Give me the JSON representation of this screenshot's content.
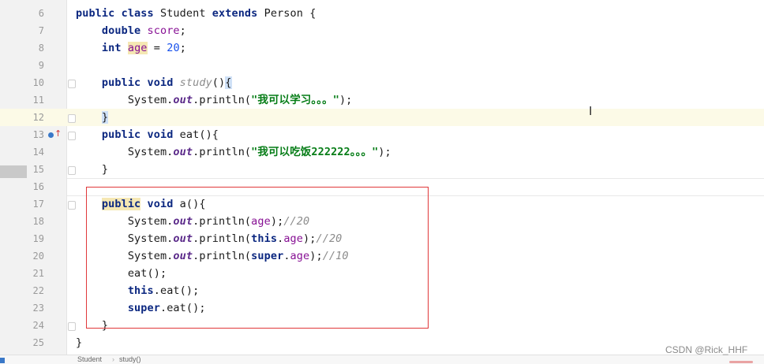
{
  "editor": {
    "lines": [
      {
        "num": "6",
        "parts": [
          {
            "t": "public class ",
            "c": "kw"
          },
          {
            "t": "Student ",
            "c": "par"
          },
          {
            "t": "extends ",
            "c": "kw"
          },
          {
            "t": "Person {",
            "c": "par"
          }
        ]
      },
      {
        "num": "7",
        "parts": [
          {
            "t": "    ",
            "c": "par"
          },
          {
            "t": "double ",
            "c": "kw"
          },
          {
            "t": "score",
            "c": "fld"
          },
          {
            "t": ";",
            "c": "par"
          }
        ]
      },
      {
        "num": "8",
        "parts": [
          {
            "t": "    ",
            "c": "par"
          },
          {
            "t": "int ",
            "c": "kw"
          },
          {
            "t": "age",
            "c": "fld hl-age"
          },
          {
            "t": " = ",
            "c": "par"
          },
          {
            "t": "20",
            "c": "num"
          },
          {
            "t": ";",
            "c": "par"
          }
        ]
      },
      {
        "num": "9",
        "parts": []
      },
      {
        "num": "10",
        "parts": [
          {
            "t": "    ",
            "c": "par"
          },
          {
            "t": "public void ",
            "c": "kw"
          },
          {
            "t": "study",
            "c": "cm"
          },
          {
            "t": "()",
            "c": "par"
          },
          {
            "t": "{",
            "c": "par hl-brace"
          }
        ]
      },
      {
        "num": "11",
        "parts": [
          {
            "t": "        System.",
            "c": "par"
          },
          {
            "t": "out",
            "c": "st"
          },
          {
            "t": ".println(",
            "c": "par"
          },
          {
            "t": "\"我可以学习。。。\"",
            "c": "str"
          },
          {
            "t": ");",
            "c": "par"
          }
        ]
      },
      {
        "num": "12",
        "parts": [
          {
            "t": "    ",
            "c": "par"
          },
          {
            "t": "}",
            "c": "par hl-brace"
          }
        ]
      },
      {
        "num": "13",
        "parts": [
          {
            "t": "    ",
            "c": "par"
          },
          {
            "t": "public void ",
            "c": "kw"
          },
          {
            "t": "eat(){",
            "c": "par"
          }
        ]
      },
      {
        "num": "14",
        "parts": [
          {
            "t": "        System.",
            "c": "par"
          },
          {
            "t": "out",
            "c": "st"
          },
          {
            "t": ".println(",
            "c": "par"
          },
          {
            "t": "\"我可以吃饭222222。。。\"",
            "c": "str"
          },
          {
            "t": ");",
            "c": "par"
          }
        ]
      },
      {
        "num": "15",
        "parts": [
          {
            "t": "    }",
            "c": "par"
          }
        ]
      },
      {
        "num": "16",
        "parts": []
      },
      {
        "num": "17",
        "parts": [
          {
            "t": "    ",
            "c": "par"
          },
          {
            "t": "public",
            "c": "kw hl-kw"
          },
          {
            "t": " void ",
            "c": "kw"
          },
          {
            "t": "a(){",
            "c": "par"
          }
        ]
      },
      {
        "num": "18",
        "parts": [
          {
            "t": "        System.",
            "c": "par"
          },
          {
            "t": "out",
            "c": "st"
          },
          {
            "t": ".println(",
            "c": "par"
          },
          {
            "t": "age",
            "c": "fld"
          },
          {
            "t": ");",
            "c": "par"
          },
          {
            "t": "//20",
            "c": "cm"
          }
        ]
      },
      {
        "num": "19",
        "parts": [
          {
            "t": "        System.",
            "c": "par"
          },
          {
            "t": "out",
            "c": "st"
          },
          {
            "t": ".println(",
            "c": "par"
          },
          {
            "t": "this",
            "c": "kw"
          },
          {
            "t": ".",
            "c": "par"
          },
          {
            "t": "age",
            "c": "fld"
          },
          {
            "t": ");",
            "c": "par"
          },
          {
            "t": "//20",
            "c": "cm"
          }
        ]
      },
      {
        "num": "20",
        "parts": [
          {
            "t": "        System.",
            "c": "par"
          },
          {
            "t": "out",
            "c": "st"
          },
          {
            "t": ".println(",
            "c": "par"
          },
          {
            "t": "super",
            "c": "kw"
          },
          {
            "t": ".",
            "c": "par"
          },
          {
            "t": "age",
            "c": "fld"
          },
          {
            "t": ");",
            "c": "par"
          },
          {
            "t": "//10",
            "c": "cm"
          }
        ]
      },
      {
        "num": "21",
        "parts": [
          {
            "t": "        eat();",
            "c": "par"
          }
        ]
      },
      {
        "num": "22",
        "parts": [
          {
            "t": "        ",
            "c": "par"
          },
          {
            "t": "this",
            "c": "kw"
          },
          {
            "t": ".eat();",
            "c": "par"
          }
        ]
      },
      {
        "num": "23",
        "parts": [
          {
            "t": "        ",
            "c": "par"
          },
          {
            "t": "super",
            "c": "kw"
          },
          {
            "t": ".eat();",
            "c": "par"
          }
        ]
      },
      {
        "num": "24",
        "parts": [
          {
            "t": "    }",
            "c": "par"
          }
        ]
      },
      {
        "num": "25",
        "parts": [
          {
            "t": "}",
            "c": "par"
          }
        ]
      }
    ]
  },
  "breadcrumb": {
    "items": [
      "Student",
      "study()"
    ],
    "separator": "›"
  },
  "watermark": "CSDN @Rick_HHF",
  "icons": {
    "override_marker": "override-up-arrow-icon",
    "text_cursor": "text-cursor-icon",
    "cursor_glyph": "I"
  },
  "colors": {
    "keyword": "#0b2780",
    "string": "#067d17",
    "number": "#1750eb",
    "field": "#871094",
    "comment": "#8c8c8c",
    "highlight_box": "#e0383a",
    "current_line": "#fcfae7"
  }
}
